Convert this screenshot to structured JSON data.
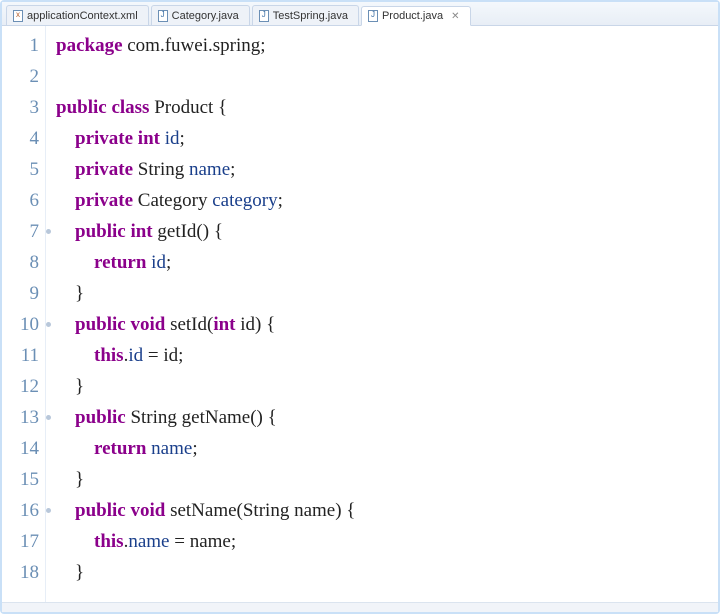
{
  "tabs": [
    {
      "label": "applicationContext.xml",
      "icon": "xml",
      "active": false
    },
    {
      "label": "Category.java",
      "icon": "java",
      "active": false
    },
    {
      "label": "TestSpring.java",
      "icon": "java",
      "active": false
    },
    {
      "label": "Product.java",
      "icon": "java",
      "active": true
    }
  ],
  "gutter": {
    "lines": [
      {
        "n": "1",
        "dot": false
      },
      {
        "n": "2",
        "dot": false
      },
      {
        "n": "3",
        "dot": false
      },
      {
        "n": "4",
        "dot": false
      },
      {
        "n": "5",
        "dot": false
      },
      {
        "n": "6",
        "dot": false
      },
      {
        "n": "7",
        "dot": true
      },
      {
        "n": "8",
        "dot": false
      },
      {
        "n": "9",
        "dot": false
      },
      {
        "n": "10",
        "dot": true
      },
      {
        "n": "11",
        "dot": false
      },
      {
        "n": "12",
        "dot": false
      },
      {
        "n": "13",
        "dot": true
      },
      {
        "n": "14",
        "dot": false
      },
      {
        "n": "15",
        "dot": false
      },
      {
        "n": "16",
        "dot": true
      },
      {
        "n": "17",
        "dot": false
      },
      {
        "n": "18",
        "dot": false
      }
    ]
  },
  "code": {
    "l1": {
      "a": "package",
      "b": " com.fuwei.spring;"
    },
    "l2": {
      "a": ""
    },
    "l3": {
      "a": "public",
      "b": " ",
      "c": "class",
      "d": " Product {"
    },
    "l4": {
      "a": "    ",
      "b": "private",
      "c": " ",
      "d": "int",
      "e": " ",
      "f": "id",
      "g": ";"
    },
    "l5": {
      "a": "    ",
      "b": "private",
      "c": " String ",
      "d": "name",
      "e": ";"
    },
    "l6": {
      "a": "    ",
      "b": "private",
      "c": " Category ",
      "d": "category",
      "e": ";"
    },
    "l7": {
      "a": "    ",
      "b": "public",
      "c": " ",
      "d": "int",
      "e": " getId() {"
    },
    "l8": {
      "a": "        ",
      "b": "return",
      "c": " ",
      "d": "id",
      "e": ";"
    },
    "l9": {
      "a": "    }"
    },
    "l10": {
      "a": "    ",
      "b": "public",
      "c": " ",
      "d": "void",
      "e": " setId(",
      "f": "int",
      "g": " id) {"
    },
    "l11": {
      "a": "        ",
      "b": "this",
      "c": ".",
      "d": "id",
      "e": " = id;"
    },
    "l12": {
      "a": "    }"
    },
    "l13": {
      "a": "    ",
      "b": "public",
      "c": " String getName() {"
    },
    "l14": {
      "a": "        ",
      "b": "return",
      "c": " ",
      "d": "name",
      "e": ";"
    },
    "l15": {
      "a": "    }"
    },
    "l16": {
      "a": "    ",
      "b": "public",
      "c": " ",
      "d": "void",
      "e": " setName(String name) {"
    },
    "l17": {
      "a": "        ",
      "b": "this",
      "c": ".",
      "d": "name",
      "e": " = name;"
    },
    "l18": {
      "a": "    }"
    }
  },
  "close_glyph": "✕"
}
